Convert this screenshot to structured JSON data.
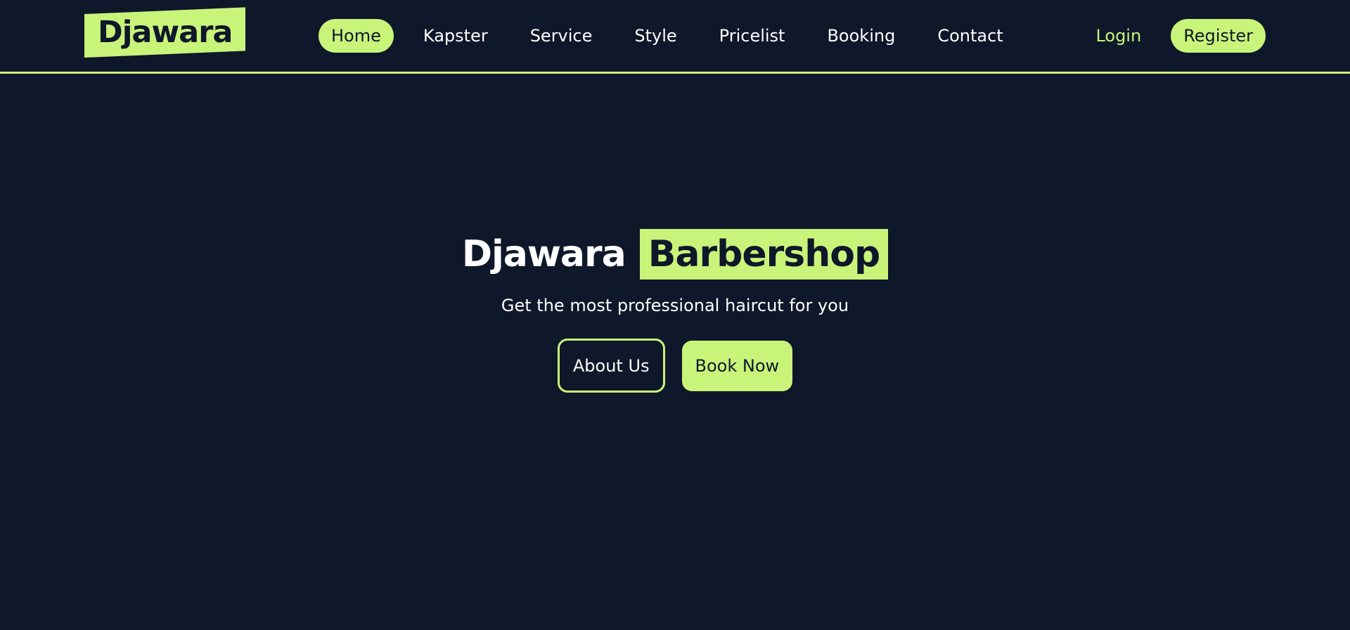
{
  "brand": {
    "logo_text": "Djawara",
    "accent_color": "#c8f47a",
    "background_color": "#0f172a"
  },
  "nav": {
    "items": [
      {
        "label": "Home",
        "active": true
      },
      {
        "label": "Kapster",
        "active": false
      },
      {
        "label": "Service",
        "active": false
      },
      {
        "label": "Style",
        "active": false
      },
      {
        "label": "Pricelist",
        "active": false
      },
      {
        "label": "Booking",
        "active": false
      },
      {
        "label": "Contact",
        "active": false
      }
    ]
  },
  "auth": {
    "login_label": "Login",
    "register_label": "Register"
  },
  "hero": {
    "title_part1": "Djawara",
    "title_part2": "Barbershop",
    "subtitle": "Get the most professional haircut for you",
    "about_button": "About Us",
    "book_button": "Book Now"
  }
}
